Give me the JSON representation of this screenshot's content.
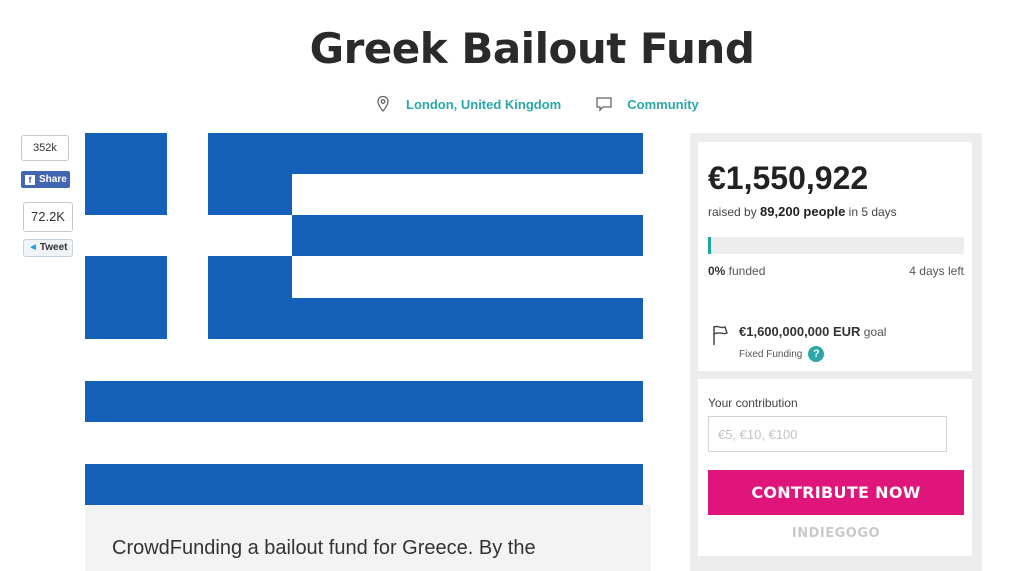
{
  "campaign": {
    "title": "Greek Bailout Fund",
    "location": "London, United Kingdom",
    "category": "Community",
    "description_start": "CrowdFunding a bailout fund for Greece. By the"
  },
  "social": {
    "facebook_count": "352k",
    "facebook_label": "Share",
    "twitter_count": "72.2K",
    "twitter_label": "Tweet"
  },
  "funding": {
    "amount_raised": "€1,550,922",
    "raised_prefix": "raised by ",
    "people": "89,200 people",
    "raised_suffix": " in 5 days",
    "percent_funded": "0%",
    "funded_label": " funded",
    "progress_fraction": 0.01,
    "days_left": "4 days left",
    "goal_amount": "€1,600,000,000 EUR",
    "goal_label": " goal",
    "funding_type": "Fixed Funding",
    "help_symbol": "?"
  },
  "contribution": {
    "label": "Your contribution",
    "placeholder": "€5, €10, €100",
    "button_label": "CONTRIBUTE NOW",
    "brand": "INDIEGOGO"
  },
  "colors": {
    "accent_teal": "#2aa8a8",
    "progress": "#1ca79b",
    "cta": "#e0157b",
    "flag_blue": "#1560b8"
  },
  "icons": {
    "location": "map-pin-icon",
    "category": "speech-bubble-icon",
    "goal": "flag-icon",
    "help": "question-icon"
  }
}
